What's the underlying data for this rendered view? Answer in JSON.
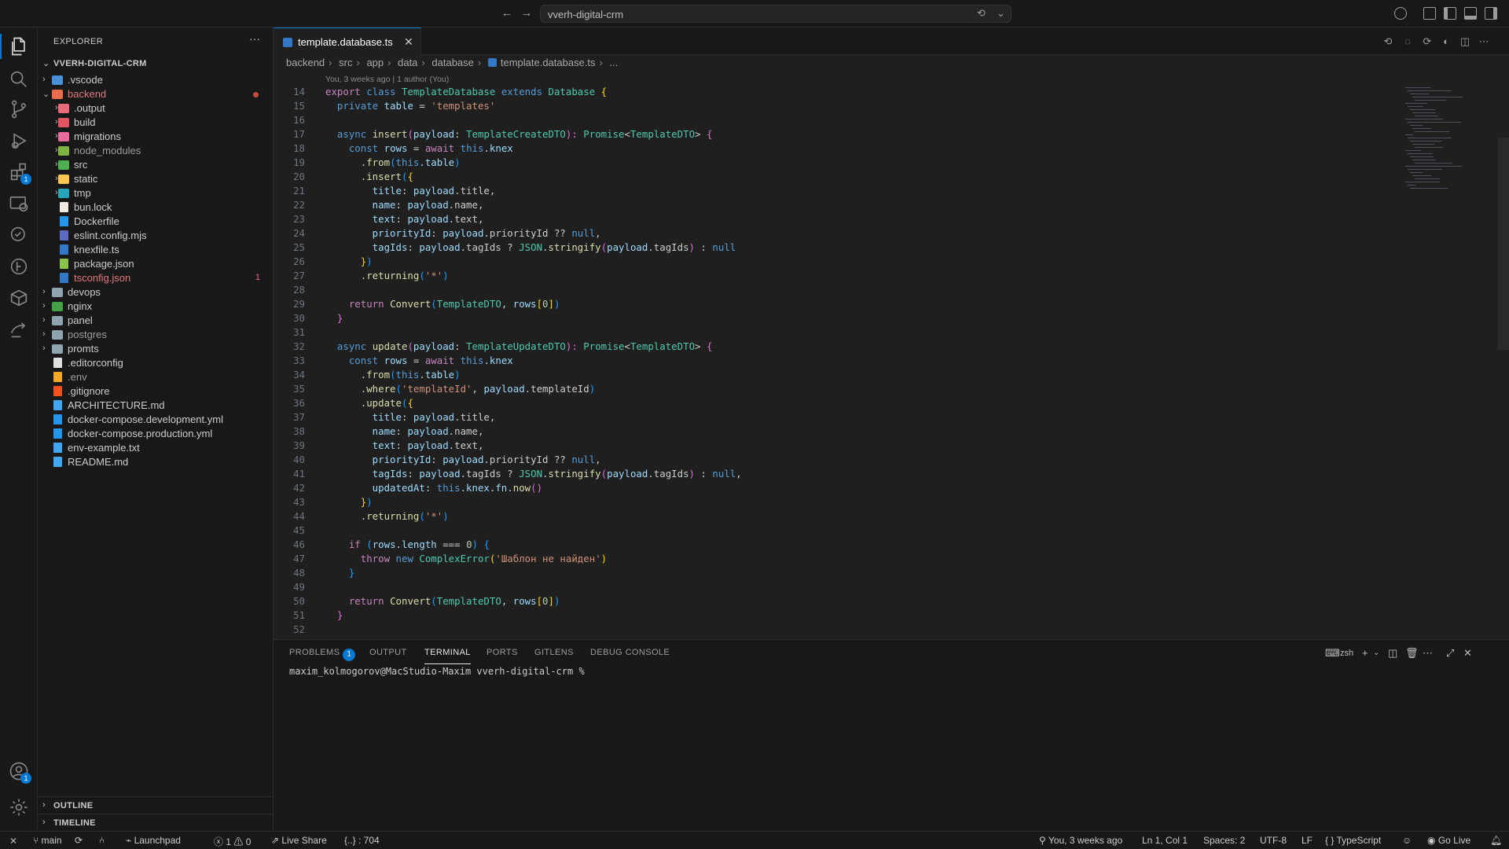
{
  "titlebar": {
    "command_center": "vverh-digital-crm",
    "back": "←",
    "forward": "→"
  },
  "activity": {
    "extensions_badge": "1",
    "accounts_badge": "1"
  },
  "sidebar": {
    "title": "EXPLORER",
    "more": "···",
    "root": "VVERH-DIGITAL-CRM",
    "outline": "OUTLINE",
    "timeline": "TIMELINE",
    "items": [
      {
        "label": ".vscode",
        "depth": 1,
        "type": "folder",
        "color": "#4a90d9"
      },
      {
        "label": "backend",
        "depth": 1,
        "type": "folder-open",
        "color": "#e96c4c",
        "text_color": "#e2787a",
        "dot": true
      },
      {
        "label": ".output",
        "depth": 2,
        "type": "folder",
        "color": "#e96c7c"
      },
      {
        "label": "build",
        "depth": 2,
        "type": "folder",
        "color": "#e25563"
      },
      {
        "label": "migrations",
        "depth": 2,
        "type": "folder",
        "color": "#e96c9c"
      },
      {
        "label": "node_modules",
        "depth": 2,
        "type": "folder",
        "color": "#7cb342",
        "text_color": "#9d9d9d"
      },
      {
        "label": "src",
        "depth": 2,
        "type": "folder",
        "color": "#4caf50"
      },
      {
        "label": "static",
        "depth": 2,
        "type": "folder",
        "color": "#f9c74f"
      },
      {
        "label": "tmp",
        "depth": 2,
        "type": "folder",
        "color": "#26a6b8"
      },
      {
        "label": "bun.lock",
        "depth": 2,
        "type": "file",
        "color": "#f2e9e1"
      },
      {
        "label": "Dockerfile",
        "depth": 2,
        "type": "file",
        "color": "#2496ed"
      },
      {
        "label": "eslint.config.mjs",
        "depth": 2,
        "type": "file",
        "color": "#5c6bc0"
      },
      {
        "label": "knexfile.ts",
        "depth": 2,
        "type": "file",
        "color": "#3178c6"
      },
      {
        "label": "package.json",
        "depth": 2,
        "type": "file",
        "color": "#8bc34a"
      },
      {
        "label": "tsconfig.json",
        "depth": 2,
        "type": "file",
        "color": "#3178c6",
        "text_color": "#e2787a",
        "count": "1"
      },
      {
        "label": "devops",
        "depth": 1,
        "type": "folder",
        "color": "#90a4ae"
      },
      {
        "label": "nginx",
        "depth": 1,
        "type": "folder",
        "color": "#43a047"
      },
      {
        "label": "panel",
        "depth": 1,
        "type": "folder",
        "color": "#90a4ae"
      },
      {
        "label": "postgres",
        "depth": 1,
        "type": "folder",
        "color": "#90a4ae",
        "text_color": "#9d9d9d"
      },
      {
        "label": "promts",
        "depth": 1,
        "type": "folder",
        "color": "#90a4ae"
      },
      {
        "label": ".editorconfig",
        "depth": 0,
        "type": "file",
        "color": "#e0e0e0"
      },
      {
        "label": ".env",
        "depth": 0,
        "type": "file",
        "color": "#f9a825",
        "text_color": "#9d9d9d"
      },
      {
        "label": ".gitignore",
        "depth": 0,
        "type": "file",
        "color": "#f4511e"
      },
      {
        "label": "ARCHITECTURE.md",
        "depth": 0,
        "type": "file",
        "color": "#42a5f5"
      },
      {
        "label": "docker-compose.development.yml",
        "depth": 0,
        "type": "file",
        "color": "#2496ed"
      },
      {
        "label": "docker-compose.production.yml",
        "depth": 0,
        "type": "file",
        "color": "#2496ed"
      },
      {
        "label": "env-example.txt",
        "depth": 0,
        "type": "file",
        "color": "#42a5f5"
      },
      {
        "label": "README.md",
        "depth": 0,
        "type": "file",
        "color": "#42a5f5"
      }
    ]
  },
  "editor": {
    "tab_label": "template.database.ts",
    "breadcrumb": [
      "backend",
      "src",
      "app",
      "data",
      "database",
      "template.database.ts",
      "..."
    ],
    "blame": "You, 3 weeks ago | 1 author (You)",
    "lines": [
      {
        "n": "14",
        "t": [
          [
            "export ",
            "kc"
          ],
          [
            "class ",
            "kw"
          ],
          [
            "TemplateDatabase ",
            "cls"
          ],
          [
            "extends ",
            "kw"
          ],
          [
            "Database ",
            "cls"
          ],
          [
            "{",
            "b1"
          ]
        ]
      },
      {
        "n": "15",
        "t": [
          [
            "  private ",
            "kw"
          ],
          [
            "table ",
            "prm"
          ],
          [
            "= ",
            "pun"
          ],
          [
            "'templates'",
            "str"
          ]
        ]
      },
      {
        "n": "16",
        "t": []
      },
      {
        "n": "17",
        "t": [
          [
            "  async ",
            "kw"
          ],
          [
            "insert",
            "fn"
          ],
          [
            "(",
            "b2"
          ],
          [
            "payload",
            "prm"
          ],
          [
            ": ",
            "pun"
          ],
          [
            "TemplateCreateDTO",
            "cls"
          ],
          [
            "): ",
            "b2"
          ],
          [
            "Promise",
            "cls"
          ],
          [
            "<",
            "pun"
          ],
          [
            "TemplateDTO",
            "cls"
          ],
          [
            "> ",
            "pun"
          ],
          [
            "{",
            "b2"
          ]
        ]
      },
      {
        "n": "18",
        "t": [
          [
            "    const ",
            "kw"
          ],
          [
            "rows ",
            "prm"
          ],
          [
            "= ",
            "pun"
          ],
          [
            "await ",
            "kc"
          ],
          [
            "this",
            "kw"
          ],
          [
            ".knex",
            "prm"
          ]
        ]
      },
      {
        "n": "19",
        "t": [
          [
            "      .",
            "pun"
          ],
          [
            "from",
            "fn"
          ],
          [
            "(",
            "b3"
          ],
          [
            "this",
            "kw"
          ],
          [
            ".table",
            "prm"
          ],
          [
            ")",
            "b3"
          ]
        ]
      },
      {
        "n": "20",
        "t": [
          [
            "      .",
            "pun"
          ],
          [
            "insert",
            "fn"
          ],
          [
            "(",
            "b3"
          ],
          [
            "{",
            "b1"
          ]
        ]
      },
      {
        "n": "21",
        "t": [
          [
            "        title",
            "prm"
          ],
          [
            ": ",
            "pun"
          ],
          [
            "payload",
            "prm"
          ],
          [
            ".title,",
            "pun"
          ]
        ]
      },
      {
        "n": "22",
        "t": [
          [
            "        name",
            "prm"
          ],
          [
            ": ",
            "pun"
          ],
          [
            "payload",
            "prm"
          ],
          [
            ".name,",
            "pun"
          ]
        ]
      },
      {
        "n": "23",
        "t": [
          [
            "        text",
            "prm"
          ],
          [
            ": ",
            "pun"
          ],
          [
            "payload",
            "prm"
          ],
          [
            ".text,",
            "pun"
          ]
        ]
      },
      {
        "n": "24",
        "t": [
          [
            "        priorityId",
            "prm"
          ],
          [
            ": ",
            "pun"
          ],
          [
            "payload",
            "prm"
          ],
          [
            ".priorityId ?? ",
            "pun"
          ],
          [
            "null",
            "kw"
          ],
          [
            ",",
            "pun"
          ]
        ]
      },
      {
        "n": "25",
        "t": [
          [
            "        tagIds",
            "prm"
          ],
          [
            ": ",
            "pun"
          ],
          [
            "payload",
            "prm"
          ],
          [
            ".tagIds ? ",
            "pun"
          ],
          [
            "JSON",
            "cls"
          ],
          [
            ".",
            "pun"
          ],
          [
            "stringify",
            "fn"
          ],
          [
            "(",
            "b2"
          ],
          [
            "payload",
            "prm"
          ],
          [
            ".tagIds",
            "pun"
          ],
          [
            ")",
            "b2"
          ],
          [
            " : ",
            "pun"
          ],
          [
            "null",
            "kw"
          ]
        ]
      },
      {
        "n": "26",
        "t": [
          [
            "      }",
            "b1"
          ],
          [
            ")",
            "b3"
          ]
        ]
      },
      {
        "n": "27",
        "t": [
          [
            "      .",
            "pun"
          ],
          [
            "returning",
            "fn"
          ],
          [
            "(",
            "b3"
          ],
          [
            "'*'",
            "str"
          ],
          [
            ")",
            "b3"
          ]
        ]
      },
      {
        "n": "28",
        "t": []
      },
      {
        "n": "29",
        "t": [
          [
            "    return ",
            "kc"
          ],
          [
            "Convert",
            "fn"
          ],
          [
            "(",
            "b3"
          ],
          [
            "TemplateDTO",
            "cls"
          ],
          [
            ", ",
            "pun"
          ],
          [
            "rows",
            "prm"
          ],
          [
            "[",
            "b1"
          ],
          [
            "0",
            "num"
          ],
          [
            "]",
            "b1"
          ],
          [
            ")",
            "b3"
          ]
        ]
      },
      {
        "n": "30",
        "t": [
          [
            "  }",
            "b2"
          ]
        ]
      },
      {
        "n": "31",
        "t": []
      },
      {
        "n": "32",
        "t": [
          [
            "  async ",
            "kw"
          ],
          [
            "update",
            "fn"
          ],
          [
            "(",
            "b2"
          ],
          [
            "payload",
            "prm"
          ],
          [
            ": ",
            "pun"
          ],
          [
            "TemplateUpdateDTO",
            "cls"
          ],
          [
            "): ",
            "b2"
          ],
          [
            "Promise",
            "cls"
          ],
          [
            "<",
            "pun"
          ],
          [
            "TemplateDTO",
            "cls"
          ],
          [
            "> ",
            "pun"
          ],
          [
            "{",
            "b2"
          ]
        ]
      },
      {
        "n": "33",
        "t": [
          [
            "    const ",
            "kw"
          ],
          [
            "rows ",
            "prm"
          ],
          [
            "= ",
            "pun"
          ],
          [
            "await ",
            "kc"
          ],
          [
            "this",
            "kw"
          ],
          [
            ".knex",
            "prm"
          ]
        ]
      },
      {
        "n": "34",
        "t": [
          [
            "      .",
            "pun"
          ],
          [
            "from",
            "fn"
          ],
          [
            "(",
            "b3"
          ],
          [
            "this",
            "kw"
          ],
          [
            ".table",
            "prm"
          ],
          [
            ")",
            "b3"
          ]
        ]
      },
      {
        "n": "35",
        "t": [
          [
            "      .",
            "pun"
          ],
          [
            "where",
            "fn"
          ],
          [
            "(",
            "b3"
          ],
          [
            "'templateId'",
            "str"
          ],
          [
            ", ",
            "pun"
          ],
          [
            "payload",
            "prm"
          ],
          [
            ".templateId",
            "pun"
          ],
          [
            ")",
            "b3"
          ]
        ]
      },
      {
        "n": "36",
        "t": [
          [
            "      .",
            "pun"
          ],
          [
            "update",
            "fn"
          ],
          [
            "(",
            "b3"
          ],
          [
            "{",
            "b1"
          ]
        ]
      },
      {
        "n": "37",
        "t": [
          [
            "        title",
            "prm"
          ],
          [
            ": ",
            "pun"
          ],
          [
            "payload",
            "prm"
          ],
          [
            ".title,",
            "pun"
          ]
        ]
      },
      {
        "n": "38",
        "t": [
          [
            "        name",
            "prm"
          ],
          [
            ": ",
            "pun"
          ],
          [
            "payload",
            "prm"
          ],
          [
            ".name,",
            "pun"
          ]
        ]
      },
      {
        "n": "39",
        "t": [
          [
            "        text",
            "prm"
          ],
          [
            ": ",
            "pun"
          ],
          [
            "payload",
            "prm"
          ],
          [
            ".text,",
            "pun"
          ]
        ]
      },
      {
        "n": "40",
        "t": [
          [
            "        priorityId",
            "prm"
          ],
          [
            ": ",
            "pun"
          ],
          [
            "payload",
            "prm"
          ],
          [
            ".priorityId ?? ",
            "pun"
          ],
          [
            "null",
            "kw"
          ],
          [
            ",",
            "pun"
          ]
        ]
      },
      {
        "n": "41",
        "t": [
          [
            "        tagIds",
            "prm"
          ],
          [
            ": ",
            "pun"
          ],
          [
            "payload",
            "prm"
          ],
          [
            ".tagIds ? ",
            "pun"
          ],
          [
            "JSON",
            "cls"
          ],
          [
            ".",
            "pun"
          ],
          [
            "stringify",
            "fn"
          ],
          [
            "(",
            "b2"
          ],
          [
            "payload",
            "prm"
          ],
          [
            ".tagIds",
            "pun"
          ],
          [
            ")",
            "b2"
          ],
          [
            " : ",
            "pun"
          ],
          [
            "null",
            "kw"
          ],
          [
            ",",
            "pun"
          ]
        ]
      },
      {
        "n": "42",
        "t": [
          [
            "        updatedAt",
            "prm"
          ],
          [
            ": ",
            "pun"
          ],
          [
            "this",
            "kw"
          ],
          [
            ".knex.fn.",
            "prm"
          ],
          [
            "now",
            "fn"
          ],
          [
            "()",
            "b2"
          ]
        ]
      },
      {
        "n": "43",
        "t": [
          [
            "      }",
            "b1"
          ],
          [
            ")",
            "b3"
          ]
        ]
      },
      {
        "n": "44",
        "t": [
          [
            "      .",
            "pun"
          ],
          [
            "returning",
            "fn"
          ],
          [
            "(",
            "b3"
          ],
          [
            "'*'",
            "str"
          ],
          [
            ")",
            "b3"
          ]
        ]
      },
      {
        "n": "45",
        "t": []
      },
      {
        "n": "46",
        "t": [
          [
            "    if ",
            "kc"
          ],
          [
            "(",
            "b3"
          ],
          [
            "rows",
            "prm"
          ],
          [
            ".length ",
            "prm"
          ],
          [
            "=== ",
            "pun"
          ],
          [
            "0",
            "num"
          ],
          [
            ") ",
            "b3"
          ],
          [
            "{",
            "b3"
          ]
        ]
      },
      {
        "n": "47",
        "t": [
          [
            "      throw ",
            "kc"
          ],
          [
            "new ",
            "kw"
          ],
          [
            "ComplexError",
            "cls"
          ],
          [
            "(",
            "b1"
          ],
          [
            "'Шаблон не найден'",
            "str"
          ],
          [
            ")",
            "b1"
          ]
        ]
      },
      {
        "n": "48",
        "t": [
          [
            "    }",
            "b3"
          ]
        ]
      },
      {
        "n": "49",
        "t": []
      },
      {
        "n": "50",
        "t": [
          [
            "    return ",
            "kc"
          ],
          [
            "Convert",
            "fn"
          ],
          [
            "(",
            "b3"
          ],
          [
            "TemplateDTO",
            "cls"
          ],
          [
            ", ",
            "pun"
          ],
          [
            "rows",
            "prm"
          ],
          [
            "[",
            "b1"
          ],
          [
            "0",
            "num"
          ],
          [
            "]",
            "b1"
          ],
          [
            ")",
            "b3"
          ]
        ]
      },
      {
        "n": "51",
        "t": [
          [
            "  }",
            "b2"
          ]
        ]
      },
      {
        "n": "52",
        "t": []
      }
    ]
  },
  "panel": {
    "tabs": [
      {
        "label": "PROBLEMS",
        "badge": "1"
      },
      {
        "label": "OUTPUT"
      },
      {
        "label": "TERMINAL",
        "active": true
      },
      {
        "label": "PORTS"
      },
      {
        "label": "GITLENS"
      },
      {
        "label": "DEBUG CONSOLE"
      }
    ],
    "shell": "zsh",
    "prompt": "maxim_kolmogorov@MacStudio-Maxim vverh-digital-crm %"
  },
  "status": {
    "branch": "main",
    "launchpad": "Launchpad",
    "errors": "1",
    "warnings": "0",
    "live_share": "Live Share",
    "braces": "{..} : 704",
    "blame": "You, 3 weeks ago",
    "cursor": "Ln 1, Col 1",
    "spaces": "Spaces: 2",
    "encoding": "UTF-8",
    "eol": "LF",
    "language": "TypeScript",
    "go_live": "Go Live"
  },
  "colors": {
    "accent": "#0078d4",
    "background": "#1f1f1f",
    "sidebar": "#181818"
  }
}
